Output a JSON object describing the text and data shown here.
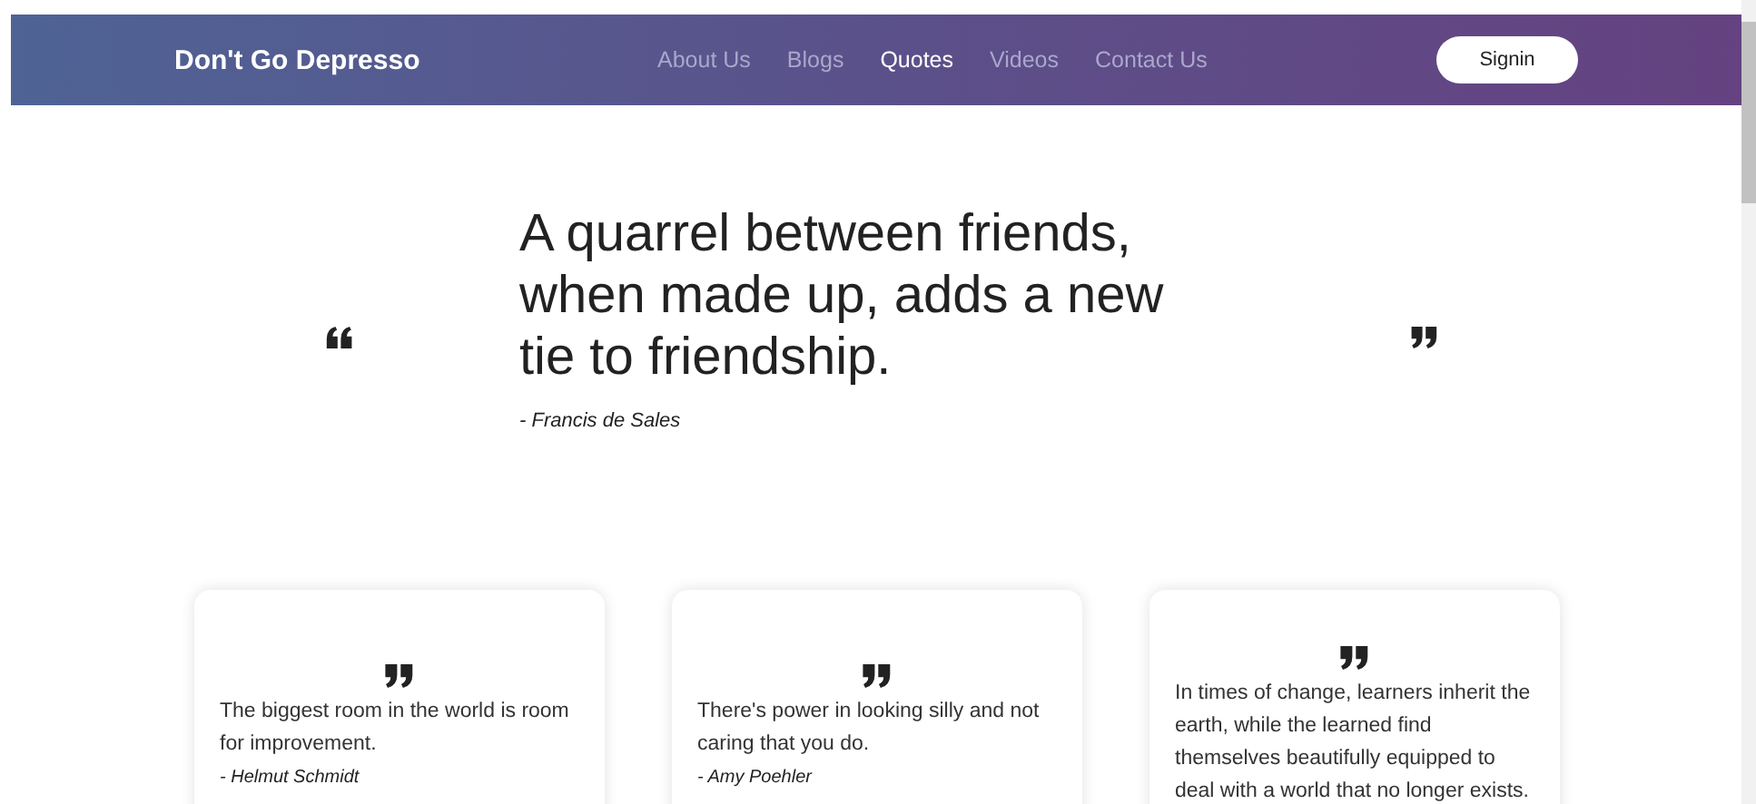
{
  "navbar": {
    "brand": "Don't Go Depresso",
    "links": [
      {
        "label": "About Us",
        "selected": false
      },
      {
        "label": "Blogs",
        "selected": false
      },
      {
        "label": "Quotes",
        "selected": true
      },
      {
        "label": "Videos",
        "selected": false
      },
      {
        "label": "Contact Us",
        "selected": false
      }
    ],
    "button": "Signin"
  },
  "hero": {
    "quote": "A quarrel between friends, when made up, adds a new tie to friendship.",
    "author": "- Francis de Sales"
  },
  "cards": [
    {
      "quote": "The biggest room in the world is room for improvement.",
      "author": "- Helmut Schmidt"
    },
    {
      "quote": "There's power in looking silly and not caring that you do.",
      "author": "- Amy Poehler"
    },
    {
      "quote": "In times of change, learners inherit the earth, while the learned find themselves beautifully equipped to deal with a world that no longer exists."
    }
  ]
}
